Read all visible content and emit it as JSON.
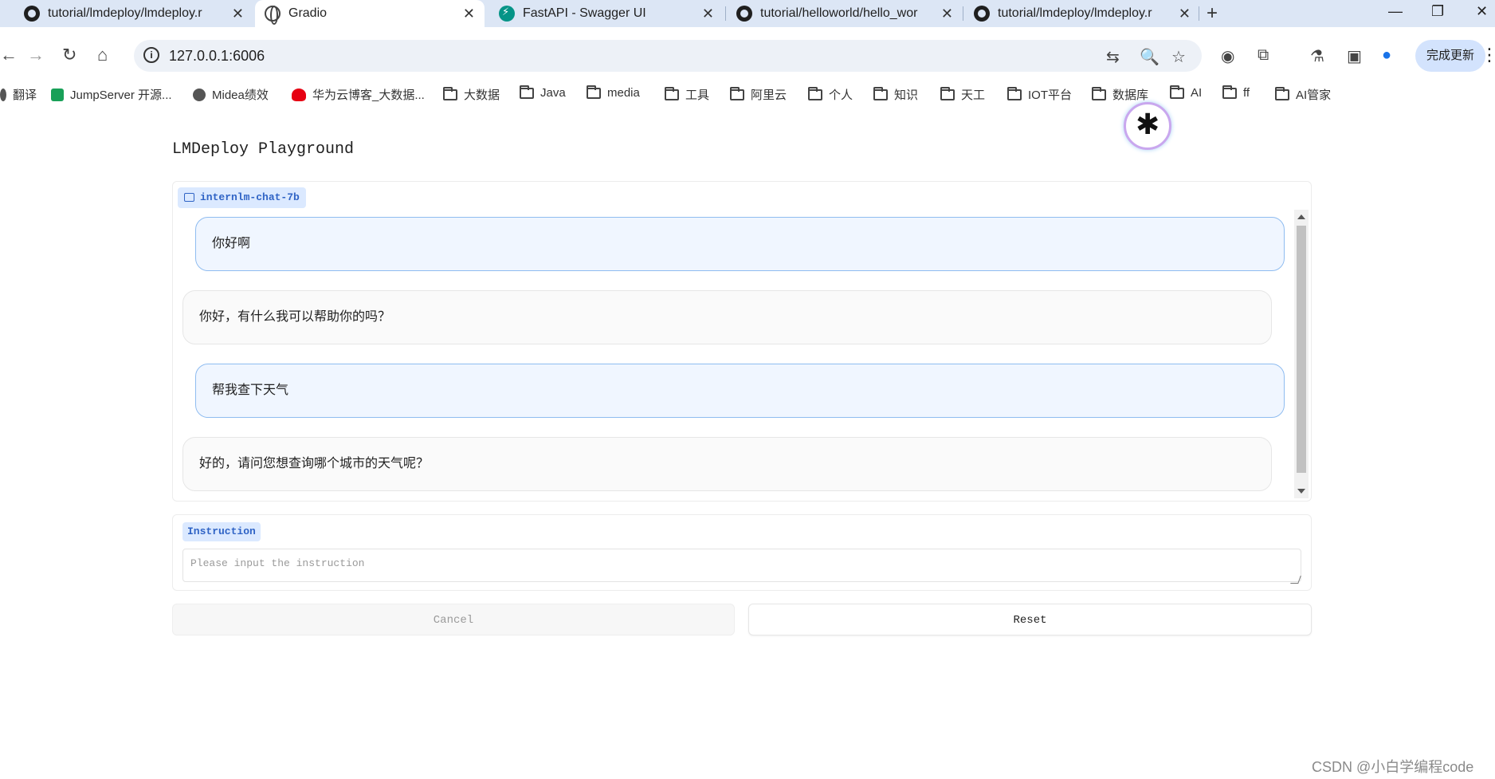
{
  "browser": {
    "tabs": [
      {
        "label": "tutorial/lmdeploy/lmdeploy.r",
        "icon": "github-icon"
      },
      {
        "label": "Gradio",
        "icon": "globe-icon",
        "active": true
      },
      {
        "label": "FastAPI - Swagger UI",
        "icon": "fastapi-icon"
      },
      {
        "label": "tutorial/helloworld/hello_wor",
        "icon": "github-icon"
      },
      {
        "label": "tutorial/lmdeploy/lmdeploy.r",
        "icon": "github-icon"
      }
    ],
    "new_tab": "+",
    "url": "127.0.0.1:6006",
    "update_button": "完成更新",
    "bookmarks": [
      {
        "label": "翻译"
      },
      {
        "label": "JumpServer 开源..."
      },
      {
        "label": "Midea绩效"
      },
      {
        "label": "华为云博客_大数据..."
      },
      {
        "label": "大数据"
      },
      {
        "label": "Java"
      },
      {
        "label": "media"
      },
      {
        "label": "工具"
      },
      {
        "label": "阿里云"
      },
      {
        "label": "个人"
      },
      {
        "label": "知识"
      },
      {
        "label": "天工"
      },
      {
        "label": "IOT平台"
      },
      {
        "label": "数据库"
      },
      {
        "label": "AI"
      },
      {
        "label": "ff"
      },
      {
        "label": "AI管家"
      }
    ]
  },
  "app": {
    "title": "LMDeploy Playground",
    "model_label": "internlm-chat-7b",
    "messages": [
      {
        "role": "user",
        "text": "你好啊"
      },
      {
        "role": "bot",
        "text": "你好，有什么我可以帮助你的吗？"
      },
      {
        "role": "user",
        "text": "帮我查下天气"
      },
      {
        "role": "bot",
        "text": "好的，请问您想查询哪个城市的天气呢？"
      }
    ],
    "instruction_label": "Instruction",
    "instruction_placeholder": "Please input the instruction",
    "cancel_label": "Cancel",
    "reset_label": "Reset"
  },
  "watermark": "CSDN @小白学编程code",
  "colors": {
    "tabstrip": "#dce6f5",
    "user_bubble": "#f0f6ff",
    "user_border": "#8fbcf0",
    "badge_bg": "#dbe9ff",
    "badge_text": "#2f63c5"
  }
}
